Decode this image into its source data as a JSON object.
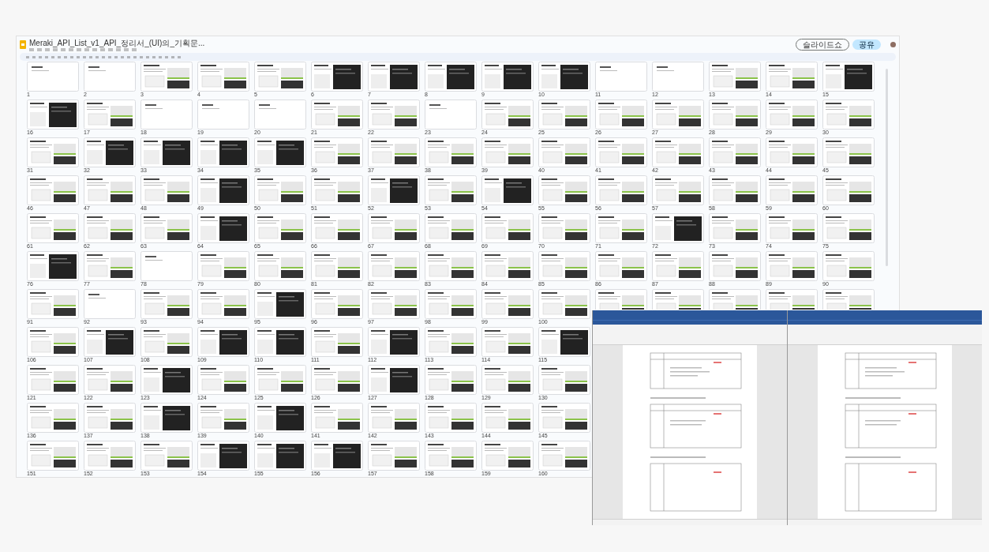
{
  "slides_window": {
    "file_name": "Meraki_API_List_v1_API_정리서_(UI)의_기획문...",
    "buttons": [
      {
        "label": "슬라이드쇼",
        "kind": "outline"
      },
      {
        "label": "공유",
        "kind": "share"
      }
    ],
    "slide_rows": [
      [
        {
          "number": "1",
          "kind": "blank"
        },
        {
          "number": "2",
          "kind": "blank"
        },
        {
          "number": "3",
          "kind": "doc"
        },
        {
          "number": "4",
          "kind": "doc"
        },
        {
          "number": "5",
          "kind": "doc"
        },
        {
          "number": "6",
          "kind": "dark"
        },
        {
          "number": "7",
          "kind": "dark"
        },
        {
          "number": "8",
          "kind": "dark"
        },
        {
          "number": "9",
          "kind": "dark"
        },
        {
          "number": "10",
          "kind": "dark"
        },
        {
          "number": "11",
          "kind": "blank"
        },
        {
          "number": "12",
          "kind": "blank"
        },
        {
          "number": "13",
          "kind": "doc"
        },
        {
          "number": "14",
          "kind": "doc"
        },
        {
          "number": "15",
          "kind": "dark"
        }
      ],
      [
        {
          "number": "16",
          "kind": "dark"
        },
        {
          "number": "17",
          "kind": "doc"
        },
        {
          "number": "18",
          "kind": "blank"
        },
        {
          "number": "19",
          "kind": "blank"
        },
        {
          "number": "20",
          "kind": "blank"
        },
        {
          "number": "21",
          "kind": "doc"
        },
        {
          "number": "22",
          "kind": "doc"
        },
        {
          "number": "23",
          "kind": "blank"
        },
        {
          "number": "24",
          "kind": "doc"
        },
        {
          "number": "25",
          "kind": "doc"
        },
        {
          "number": "26",
          "kind": "doc"
        },
        {
          "number": "27",
          "kind": "doc"
        },
        {
          "number": "28",
          "kind": "doc"
        },
        {
          "number": "29",
          "kind": "doc"
        },
        {
          "number": "30",
          "kind": "doc"
        }
      ],
      [
        {
          "number": "31",
          "kind": "doc"
        },
        {
          "number": "32",
          "kind": "dark"
        },
        {
          "number": "33",
          "kind": "dark"
        },
        {
          "number": "34",
          "kind": "dark"
        },
        {
          "number": "35",
          "kind": "dark"
        },
        {
          "number": "36",
          "kind": "doc"
        },
        {
          "number": "37",
          "kind": "doc"
        },
        {
          "number": "38",
          "kind": "doc"
        },
        {
          "number": "39",
          "kind": "doc"
        },
        {
          "number": "40",
          "kind": "doc"
        },
        {
          "number": "41",
          "kind": "doc"
        },
        {
          "number": "42",
          "kind": "doc"
        },
        {
          "number": "43",
          "kind": "doc"
        },
        {
          "number": "44",
          "kind": "doc"
        },
        {
          "number": "45",
          "kind": "doc"
        }
      ],
      [
        {
          "number": "46",
          "kind": "doc"
        },
        {
          "number": "47",
          "kind": "doc"
        },
        {
          "number": "48",
          "kind": "doc"
        },
        {
          "number": "49",
          "kind": "dark"
        },
        {
          "number": "50",
          "kind": "doc"
        },
        {
          "number": "51",
          "kind": "doc"
        },
        {
          "number": "52",
          "kind": "dark"
        },
        {
          "number": "53",
          "kind": "doc"
        },
        {
          "number": "54",
          "kind": "dark"
        },
        {
          "number": "55",
          "kind": "doc"
        },
        {
          "number": "56",
          "kind": "doc"
        },
        {
          "number": "57",
          "kind": "doc"
        },
        {
          "number": "58",
          "kind": "doc"
        },
        {
          "number": "59",
          "kind": "doc"
        },
        {
          "number": "60",
          "kind": "doc"
        }
      ],
      [
        {
          "number": "61",
          "kind": "doc"
        },
        {
          "number": "62",
          "kind": "doc"
        },
        {
          "number": "63",
          "kind": "doc"
        },
        {
          "number": "64",
          "kind": "dark"
        },
        {
          "number": "65",
          "kind": "doc"
        },
        {
          "number": "66",
          "kind": "doc"
        },
        {
          "number": "67",
          "kind": "doc"
        },
        {
          "number": "68",
          "kind": "doc"
        },
        {
          "number": "69",
          "kind": "doc"
        },
        {
          "number": "70",
          "kind": "doc"
        },
        {
          "number": "71",
          "kind": "doc"
        },
        {
          "number": "72",
          "kind": "dark"
        },
        {
          "number": "73",
          "kind": "doc"
        },
        {
          "number": "74",
          "kind": "doc"
        },
        {
          "number": "75",
          "kind": "doc"
        }
      ],
      [
        {
          "number": "76",
          "kind": "dark"
        },
        {
          "number": "77",
          "kind": "doc"
        },
        {
          "number": "78",
          "kind": "blank"
        },
        {
          "number": "79",
          "kind": "doc"
        },
        {
          "number": "80",
          "kind": "doc"
        },
        {
          "number": "81",
          "kind": "doc"
        },
        {
          "number": "82",
          "kind": "doc"
        },
        {
          "number": "83",
          "kind": "doc"
        },
        {
          "number": "84",
          "kind": "doc"
        },
        {
          "number": "85",
          "kind": "doc"
        },
        {
          "number": "86",
          "kind": "doc"
        },
        {
          "number": "87",
          "kind": "doc"
        },
        {
          "number": "88",
          "kind": "doc"
        },
        {
          "number": "89",
          "kind": "doc"
        },
        {
          "number": "90",
          "kind": "doc"
        }
      ],
      [
        {
          "number": "91",
          "kind": "doc"
        },
        {
          "number": "92",
          "kind": "blank"
        },
        {
          "number": "93",
          "kind": "doc"
        },
        {
          "number": "94",
          "kind": "doc"
        },
        {
          "number": "95",
          "kind": "dark"
        },
        {
          "number": "96",
          "kind": "doc"
        },
        {
          "number": "97",
          "kind": "doc"
        },
        {
          "number": "98",
          "kind": "doc"
        },
        {
          "number": "99",
          "kind": "doc"
        },
        {
          "number": "100",
          "kind": "doc"
        },
        {
          "kind": "doc_top"
        },
        {
          "kind": "doc_top"
        },
        {
          "kind": "doc_top"
        },
        {
          "kind": "doc_top"
        },
        {
          "kind": "doc_top"
        }
      ],
      [
        {
          "number": "106",
          "kind": "doc"
        },
        {
          "number": "107",
          "kind": "dark"
        },
        {
          "number": "108",
          "kind": "doc"
        },
        {
          "number": "109",
          "kind": "dark"
        },
        {
          "number": "110",
          "kind": "dark"
        },
        {
          "number": "111",
          "kind": "doc"
        },
        {
          "number": "112",
          "kind": "dark"
        },
        {
          "number": "113",
          "kind": "doc"
        },
        {
          "number": "114",
          "kind": "doc"
        },
        {
          "number": "115",
          "kind": "dark"
        }
      ],
      [
        {
          "number": "121",
          "kind": "doc"
        },
        {
          "number": "122",
          "kind": "doc"
        },
        {
          "number": "123",
          "kind": "dark"
        },
        {
          "number": "124",
          "kind": "doc"
        },
        {
          "number": "125",
          "kind": "doc"
        },
        {
          "number": "126",
          "kind": "doc"
        },
        {
          "number": "127",
          "kind": "dark"
        },
        {
          "number": "128",
          "kind": "doc"
        },
        {
          "number": "129",
          "kind": "doc"
        },
        {
          "number": "130",
          "kind": "doc"
        }
      ],
      [
        {
          "number": "136",
          "kind": "doc"
        },
        {
          "number": "137",
          "kind": "doc"
        },
        {
          "number": "138",
          "kind": "dark"
        },
        {
          "number": "139",
          "kind": "doc"
        },
        {
          "number": "140",
          "kind": "dark"
        },
        {
          "number": "141",
          "kind": "doc"
        },
        {
          "number": "142",
          "kind": "doc"
        },
        {
          "number": "143",
          "kind": "doc"
        },
        {
          "number": "144",
          "kind": "doc"
        },
        {
          "number": "145",
          "kind": "doc"
        }
      ],
      [
        {
          "number": "151",
          "kind": "doc"
        },
        {
          "number": "152",
          "kind": "doc"
        },
        {
          "number": "153",
          "kind": "doc"
        },
        {
          "number": "154",
          "kind": "dark"
        },
        {
          "number": "155",
          "kind": "dark"
        },
        {
          "number": "156",
          "kind": "dark"
        },
        {
          "number": "157",
          "kind": "doc"
        },
        {
          "number": "158",
          "kind": "doc"
        },
        {
          "number": "159",
          "kind": "doc"
        },
        {
          "number": "160",
          "kind": "doc"
        }
      ]
    ]
  },
  "word_windows": [
    {
      "kind": "word"
    },
    {
      "kind": "word"
    }
  ]
}
